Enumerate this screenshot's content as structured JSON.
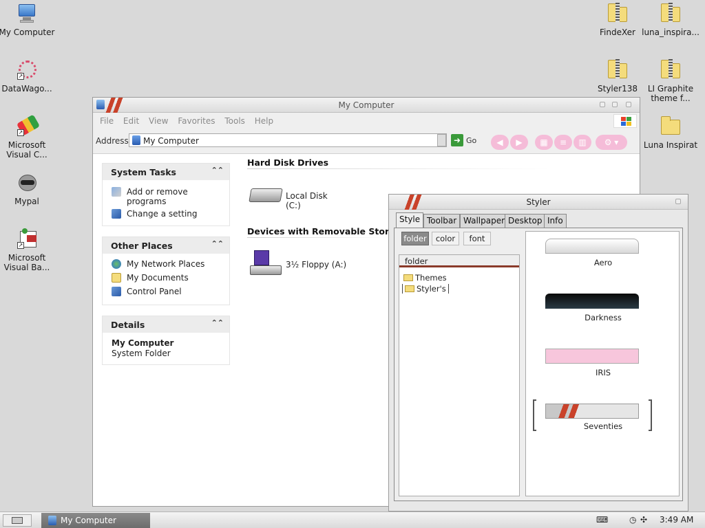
{
  "desktop": {
    "left_icons": [
      {
        "label": "My Computer"
      },
      {
        "label": "DataWago..."
      },
      {
        "label": "Microsoft Visual C..."
      },
      {
        "label": "Mypal"
      },
      {
        "label": "Microsoft Visual Ba..."
      }
    ],
    "right_icons": [
      {
        "label": "FindeXer"
      },
      {
        "label": "luna_inspira..."
      },
      {
        "label": "Styler138"
      },
      {
        "label": "LI Graphite theme f..."
      },
      {
        "label": "Luna Inspirat"
      }
    ]
  },
  "explorer": {
    "title": "My Computer",
    "menu": [
      "File",
      "Edit",
      "View",
      "Favorites",
      "Tools",
      "Help"
    ],
    "address_label": "Address",
    "address_value": "My Computer",
    "go_label": "Go",
    "panels": {
      "system_tasks": {
        "title": "System Tasks",
        "items": [
          "Add or remove programs",
          "Change a setting"
        ]
      },
      "other_places": {
        "title": "Other Places",
        "items": [
          "My Network Places",
          "My Documents",
          "Control Panel"
        ]
      },
      "details": {
        "title": "Details",
        "name": "My Computer",
        "type": "System Folder"
      }
    },
    "sections": {
      "hard_disks": {
        "title": "Hard Disk Drives",
        "items": [
          "Local Disk (C:)"
        ]
      },
      "removable": {
        "title": "Devices with Removable Storage",
        "items": [
          "3½ Floppy (A:)"
        ]
      }
    }
  },
  "styler": {
    "title": "Styler",
    "tabs": [
      "Style",
      "Toolbar",
      "Wallpaper",
      "Desktop",
      "Info"
    ],
    "active_tab": "Style",
    "sub_buttons": [
      "folder",
      "color",
      "font"
    ],
    "tree_header": "folder",
    "tree_items": [
      "Themes",
      "Styler's"
    ],
    "themes": [
      "Aero",
      "Darkness",
      "IRIS",
      "Seventies"
    ]
  },
  "taskbar": {
    "task": "My Computer",
    "clock": "3:49 AM"
  },
  "colors": {
    "desktop_bg": "#d9d9d9",
    "accent_red": "#c9422a",
    "pink_toolbar": "#f5bcd8"
  }
}
